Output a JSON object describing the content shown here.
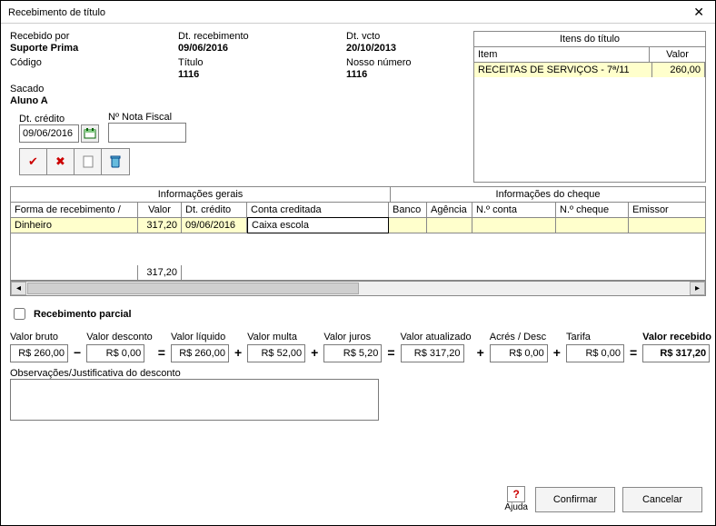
{
  "window": {
    "title": "Recebimento de título"
  },
  "header": {
    "recebido_lbl": "Recebido por",
    "recebido_val": "Suporte Prima",
    "dtreceb_lbl": "Dt. recebimento",
    "dtreceb_val": "09/06/2016",
    "dtvcto_lbl": "Dt. vcto",
    "dtvcto_val": "20/10/2013",
    "codigo_lbl": "Código",
    "codigo_val": "",
    "titulo_lbl": "Título",
    "titulo_val": "1116",
    "nosson_lbl": "Nosso número",
    "nosson_val": "1116",
    "sacado_lbl": "Sacado",
    "sacado_val": "Aluno A"
  },
  "items": {
    "title": "Itens do título",
    "col_item": "Item",
    "col_valor": "Valor",
    "rows": [
      {
        "item": "RECEITAS DE SERVIÇOS - 7ª/11",
        "valor": "260,00"
      }
    ]
  },
  "credit": {
    "dtcredito_lbl": "Dt. crédito",
    "dtcredito_val": "09/06/2016",
    "nota_lbl": "Nº Nota Fiscal",
    "nota_val": ""
  },
  "grid": {
    "group1": "Informações gerais",
    "group2": "Informações do cheque",
    "col_forma": "Forma de recebimento /",
    "col_valor": "Valor",
    "col_dtc": "Dt. crédito",
    "col_conta": "Conta creditada",
    "col_banco": "Banco",
    "col_agencia": "Agência",
    "col_nconta": "N.º conta",
    "col_ncheque": "N.º cheque",
    "col_emissor": "Emissor",
    "row": {
      "forma": "Dinheiro",
      "valor": "317,20",
      "dtc": "09/06/2016",
      "conta": "Caixa escola"
    },
    "footer_valor": "317,20"
  },
  "partial": {
    "label": "Recebimento parcial"
  },
  "vals": {
    "bruto_lbl": "Valor bruto",
    "bruto_val": "R$ 260,00",
    "desc_lbl": "Valor desconto",
    "desc_val": "R$ 0,00",
    "liq_lbl": "Valor líquido",
    "liq_val": "R$ 260,00",
    "multa_lbl": "Valor multa",
    "multa_val": "R$ 52,00",
    "juros_lbl": "Valor juros",
    "juros_val": "R$ 5,20",
    "atual_lbl": "Valor atualizado",
    "atual_val": "R$ 317,20",
    "acres_lbl": "Acrés / Desc",
    "acres_val": "R$ 0,00",
    "tarifa_lbl": "Tarifa",
    "tarifa_val": "R$ 0,00",
    "receb_lbl": "Valor recebido",
    "receb_val": "R$ 317,20"
  },
  "obs": {
    "label": "Observações/Justificativa do desconto",
    "value": ""
  },
  "footer": {
    "ajuda": "Ajuda",
    "confirmar": "Confirmar",
    "cancelar": "Cancelar"
  }
}
